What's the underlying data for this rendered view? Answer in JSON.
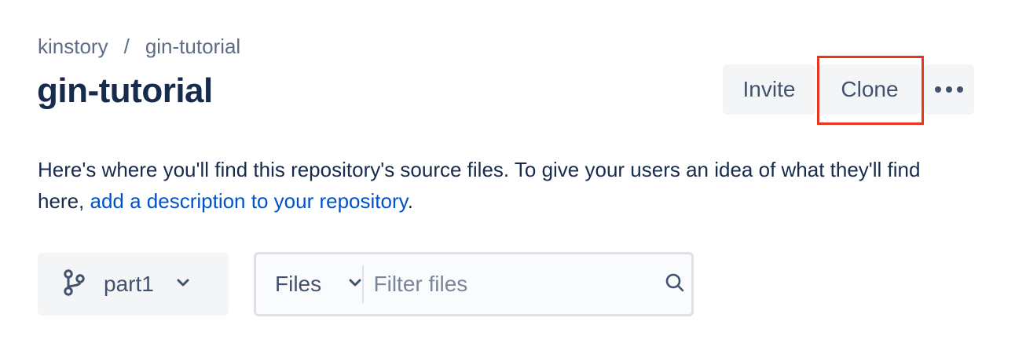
{
  "breadcrumb": {
    "workspace": "kinstory",
    "separator": "/",
    "repository": "gin-tutorial"
  },
  "header": {
    "title": "gin-tutorial",
    "invite_label": "Invite",
    "clone_label": "Clone",
    "more_icon": "more-horizontal-icon"
  },
  "description": {
    "text_before": "Here's where you'll find this repository's source files. To give your users an idea of what they'll find here,",
    "link_text": "add a description to your repository",
    "text_after": "."
  },
  "branch_selector": {
    "icon": "branch-icon",
    "label": "part1",
    "dropdown_icon": "chevron-down-icon"
  },
  "file_filter": {
    "mode_label": "Files",
    "mode_dropdown_icon": "chevron-down-icon",
    "placeholder": "Filter files",
    "value": "",
    "search_icon": "search-icon"
  },
  "colors": {
    "text_primary": "#172b4d",
    "text_secondary": "#42526e",
    "link": "#0052cc",
    "button_bg": "#f4f5f7",
    "highlight": "#e8351e"
  }
}
